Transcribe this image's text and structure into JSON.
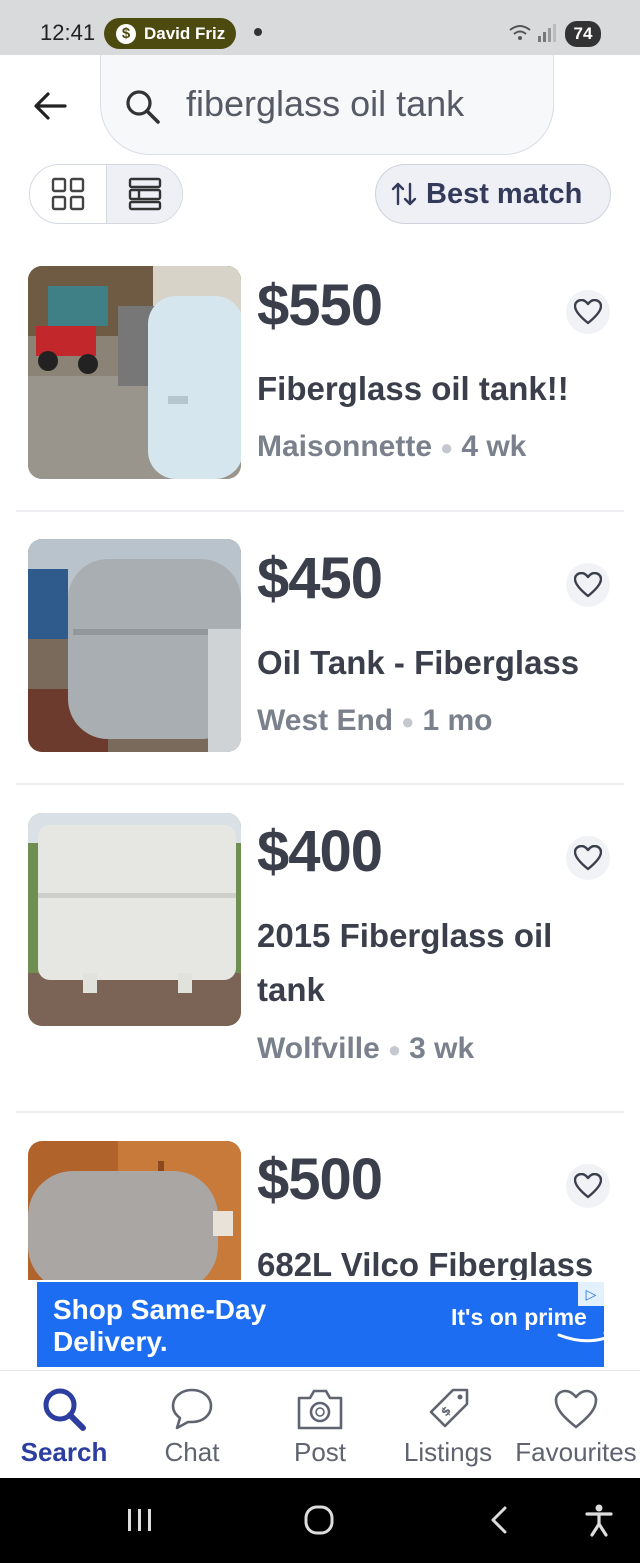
{
  "status_bar": {
    "time": "12:41",
    "contact_pill": "David Friz",
    "battery": "74"
  },
  "search": {
    "query": "fiberglass oil tank"
  },
  "sort": {
    "label": "Best match"
  },
  "listings": [
    {
      "price": "$550",
      "title": "Fiberglass oil tank!!",
      "location": "Maisonnette",
      "age": "4 wk"
    },
    {
      "price": "$450",
      "title": "Oil Tank - Fiberglass",
      "location": "West End",
      "age": "1 mo"
    },
    {
      "price": "$400",
      "title": "2015 Fiberglass oil tank",
      "location": "Wolfville",
      "age": "3 wk"
    },
    {
      "price": "$500",
      "title": "682L Vilco Fiberglass",
      "location": "",
      "age": ""
    }
  ],
  "ad": {
    "headline": "Shop Same-Day Delivery.",
    "tagline": "It's on prime"
  },
  "bottom_nav": {
    "items": [
      {
        "label": "Search",
        "active": true
      },
      {
        "label": "Chat"
      },
      {
        "label": "Post"
      },
      {
        "label": "Listings"
      },
      {
        "label": "Favourites"
      }
    ]
  },
  "colors": {
    "accent": "#2c3ea0",
    "price_text": "#3a3f4b",
    "ad_blue": "#1d6df2"
  }
}
